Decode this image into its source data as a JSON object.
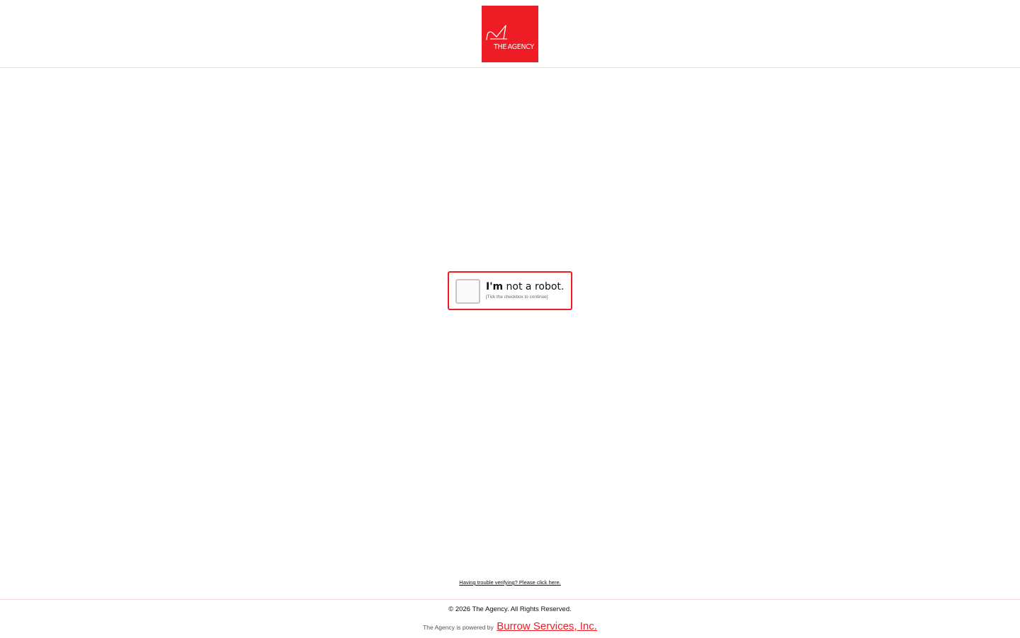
{
  "header": {
    "logo_text": "THEAGENCY",
    "logo_color": "#ee1c25"
  },
  "captcha": {
    "title_bold": "I'm",
    "title_rest": " not a robot.",
    "subtitle": "[Tick the checkbox to continue]",
    "checked": false,
    "border_color": "#ee1c25"
  },
  "trouble_link": "Having trouble verifying? Please click here.",
  "footer": {
    "copyright": "© 2026 The Agency. All Rights Reserved.",
    "powered_by": "The Agency is powered by",
    "powered_link": "Burrow Services, Inc."
  }
}
